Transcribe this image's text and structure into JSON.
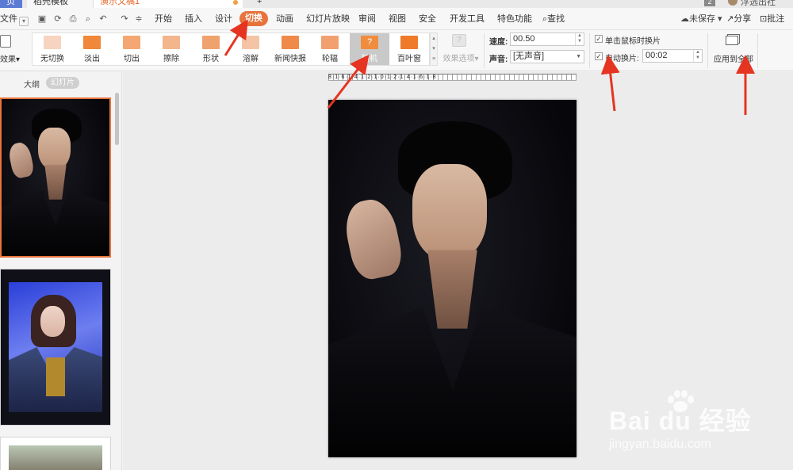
{
  "tabs": {
    "home": "页",
    "template": "稻壳模板",
    "document": "演示文稿1",
    "new": "+"
  },
  "titlebar": {
    "badge": "2",
    "user": "浮选出社"
  },
  "menu": {
    "file": "文件",
    "items": [
      "开始",
      "插入",
      "设计",
      "切换",
      "动画",
      "幻灯片放映",
      "审阅",
      "视图",
      "安全",
      "开发工具",
      "特色功能"
    ],
    "search": "查找",
    "unsaved": "未保存",
    "share": "分享",
    "comment": "批注"
  },
  "ribbon": {
    "effect_button": "效果",
    "transitions": [
      {
        "label": "无切换",
        "color": "#f7d4bf"
      },
      {
        "label": "淡出",
        "color": "#f0873a"
      },
      {
        "label": "切出",
        "color": "#f4a772"
      },
      {
        "label": "擦除",
        "color": "#f2b58c"
      },
      {
        "label": "形状",
        "color": "#f0a26e"
      },
      {
        "label": "溶解",
        "color": "#f5c4a4"
      },
      {
        "label": "新闻快报",
        "color": "#f08a4a"
      },
      {
        "label": "轮辐",
        "color": "#f2a070"
      },
      {
        "label": "随机",
        "color": "#f08c3e"
      },
      {
        "label": "百叶窗",
        "color": "#ee7a2a"
      }
    ],
    "selected_transition": "随机",
    "effect_options": "效果选项",
    "speed_label": "速度:",
    "speed_value": "00.50",
    "sound_label": "声音:",
    "sound_value": "[无声音]",
    "on_click_label": "单击鼠标时换片",
    "on_click_checked": true,
    "auto_label": "自动换片:",
    "auto_checked": true,
    "auto_value": "00:02",
    "apply_all": "应用到全部"
  },
  "left_panel": {
    "outline_tab": "大纲",
    "slides_tab": "幻灯片",
    "slide_count_visible": 3,
    "selected_slide": 1
  },
  "ruler": {
    "labels": "8·1·6·1·4·1·2·1·0·1·2·1·4·1·6·1·8"
  },
  "watermark": {
    "logo": "Bai du 经验",
    "url": "jingyan.baidu.com"
  },
  "colors": {
    "accent": "#e8733c",
    "annotation_arrow": "#e53421",
    "home_tab": "#5b7bd5"
  }
}
